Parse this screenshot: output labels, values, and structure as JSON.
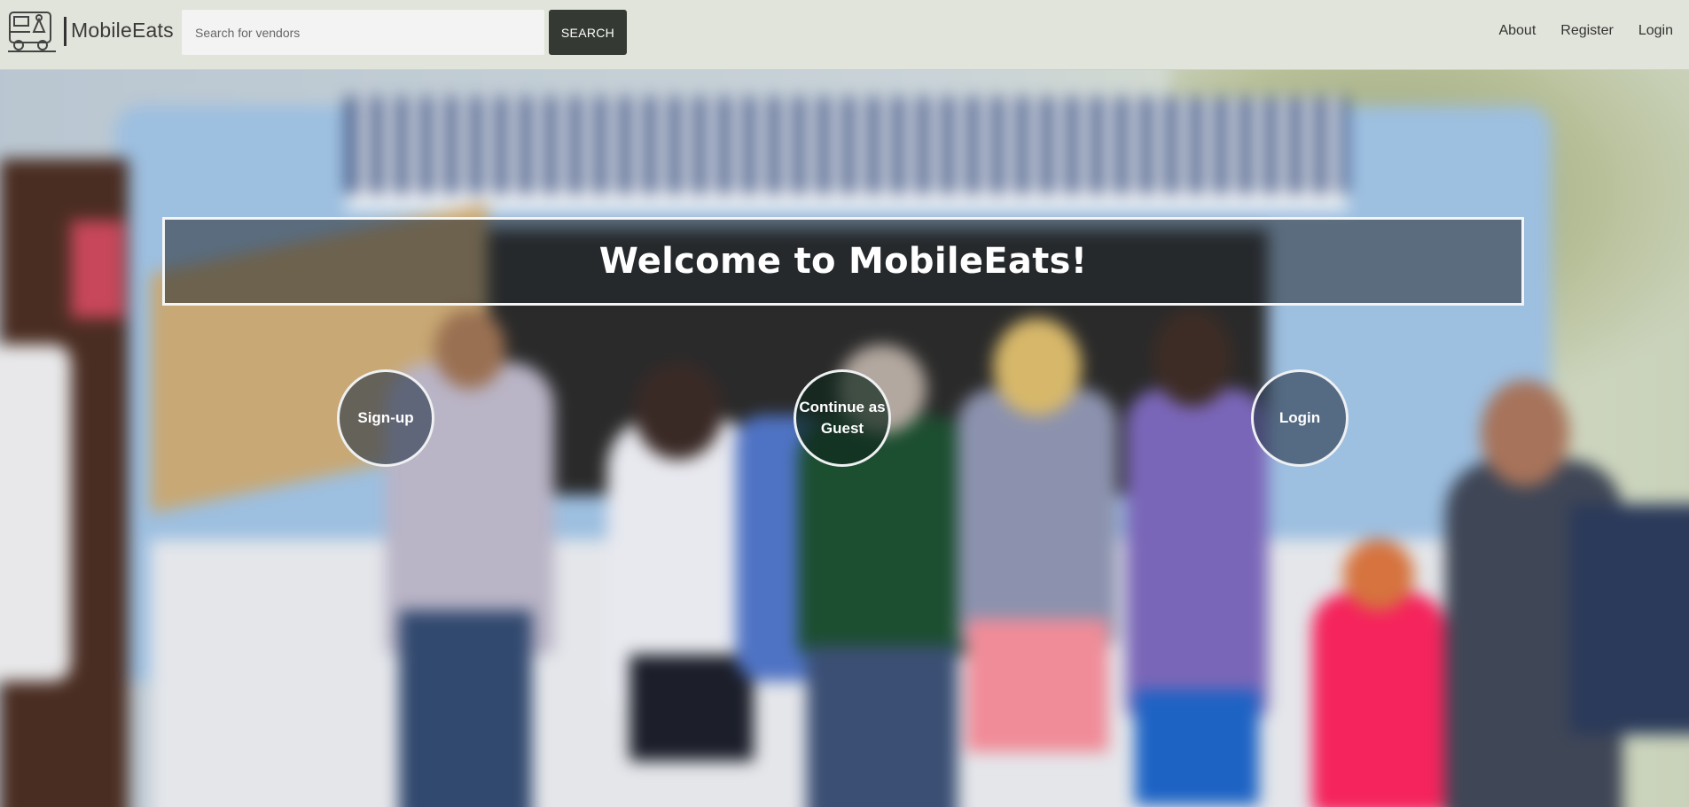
{
  "navbar": {
    "brand": "MobileEats",
    "logo_icon": "food-truck-icon",
    "search": {
      "placeholder": "Search for vendors",
      "value": "",
      "button_label": "SEARCH"
    },
    "links": [
      "About",
      "Register",
      "Login"
    ]
  },
  "hero": {
    "title": "Welcome to MobileEats!",
    "actions": {
      "signup": "Sign-up",
      "guest": "Continue as Guest",
      "login": "Login"
    }
  },
  "colors": {
    "navbar_bg": "#e1e4da",
    "search_button_bg": "#343a33",
    "banner_overlay": "rgba(35,40,45,0.55)",
    "circle_border": "#eef0f2"
  }
}
